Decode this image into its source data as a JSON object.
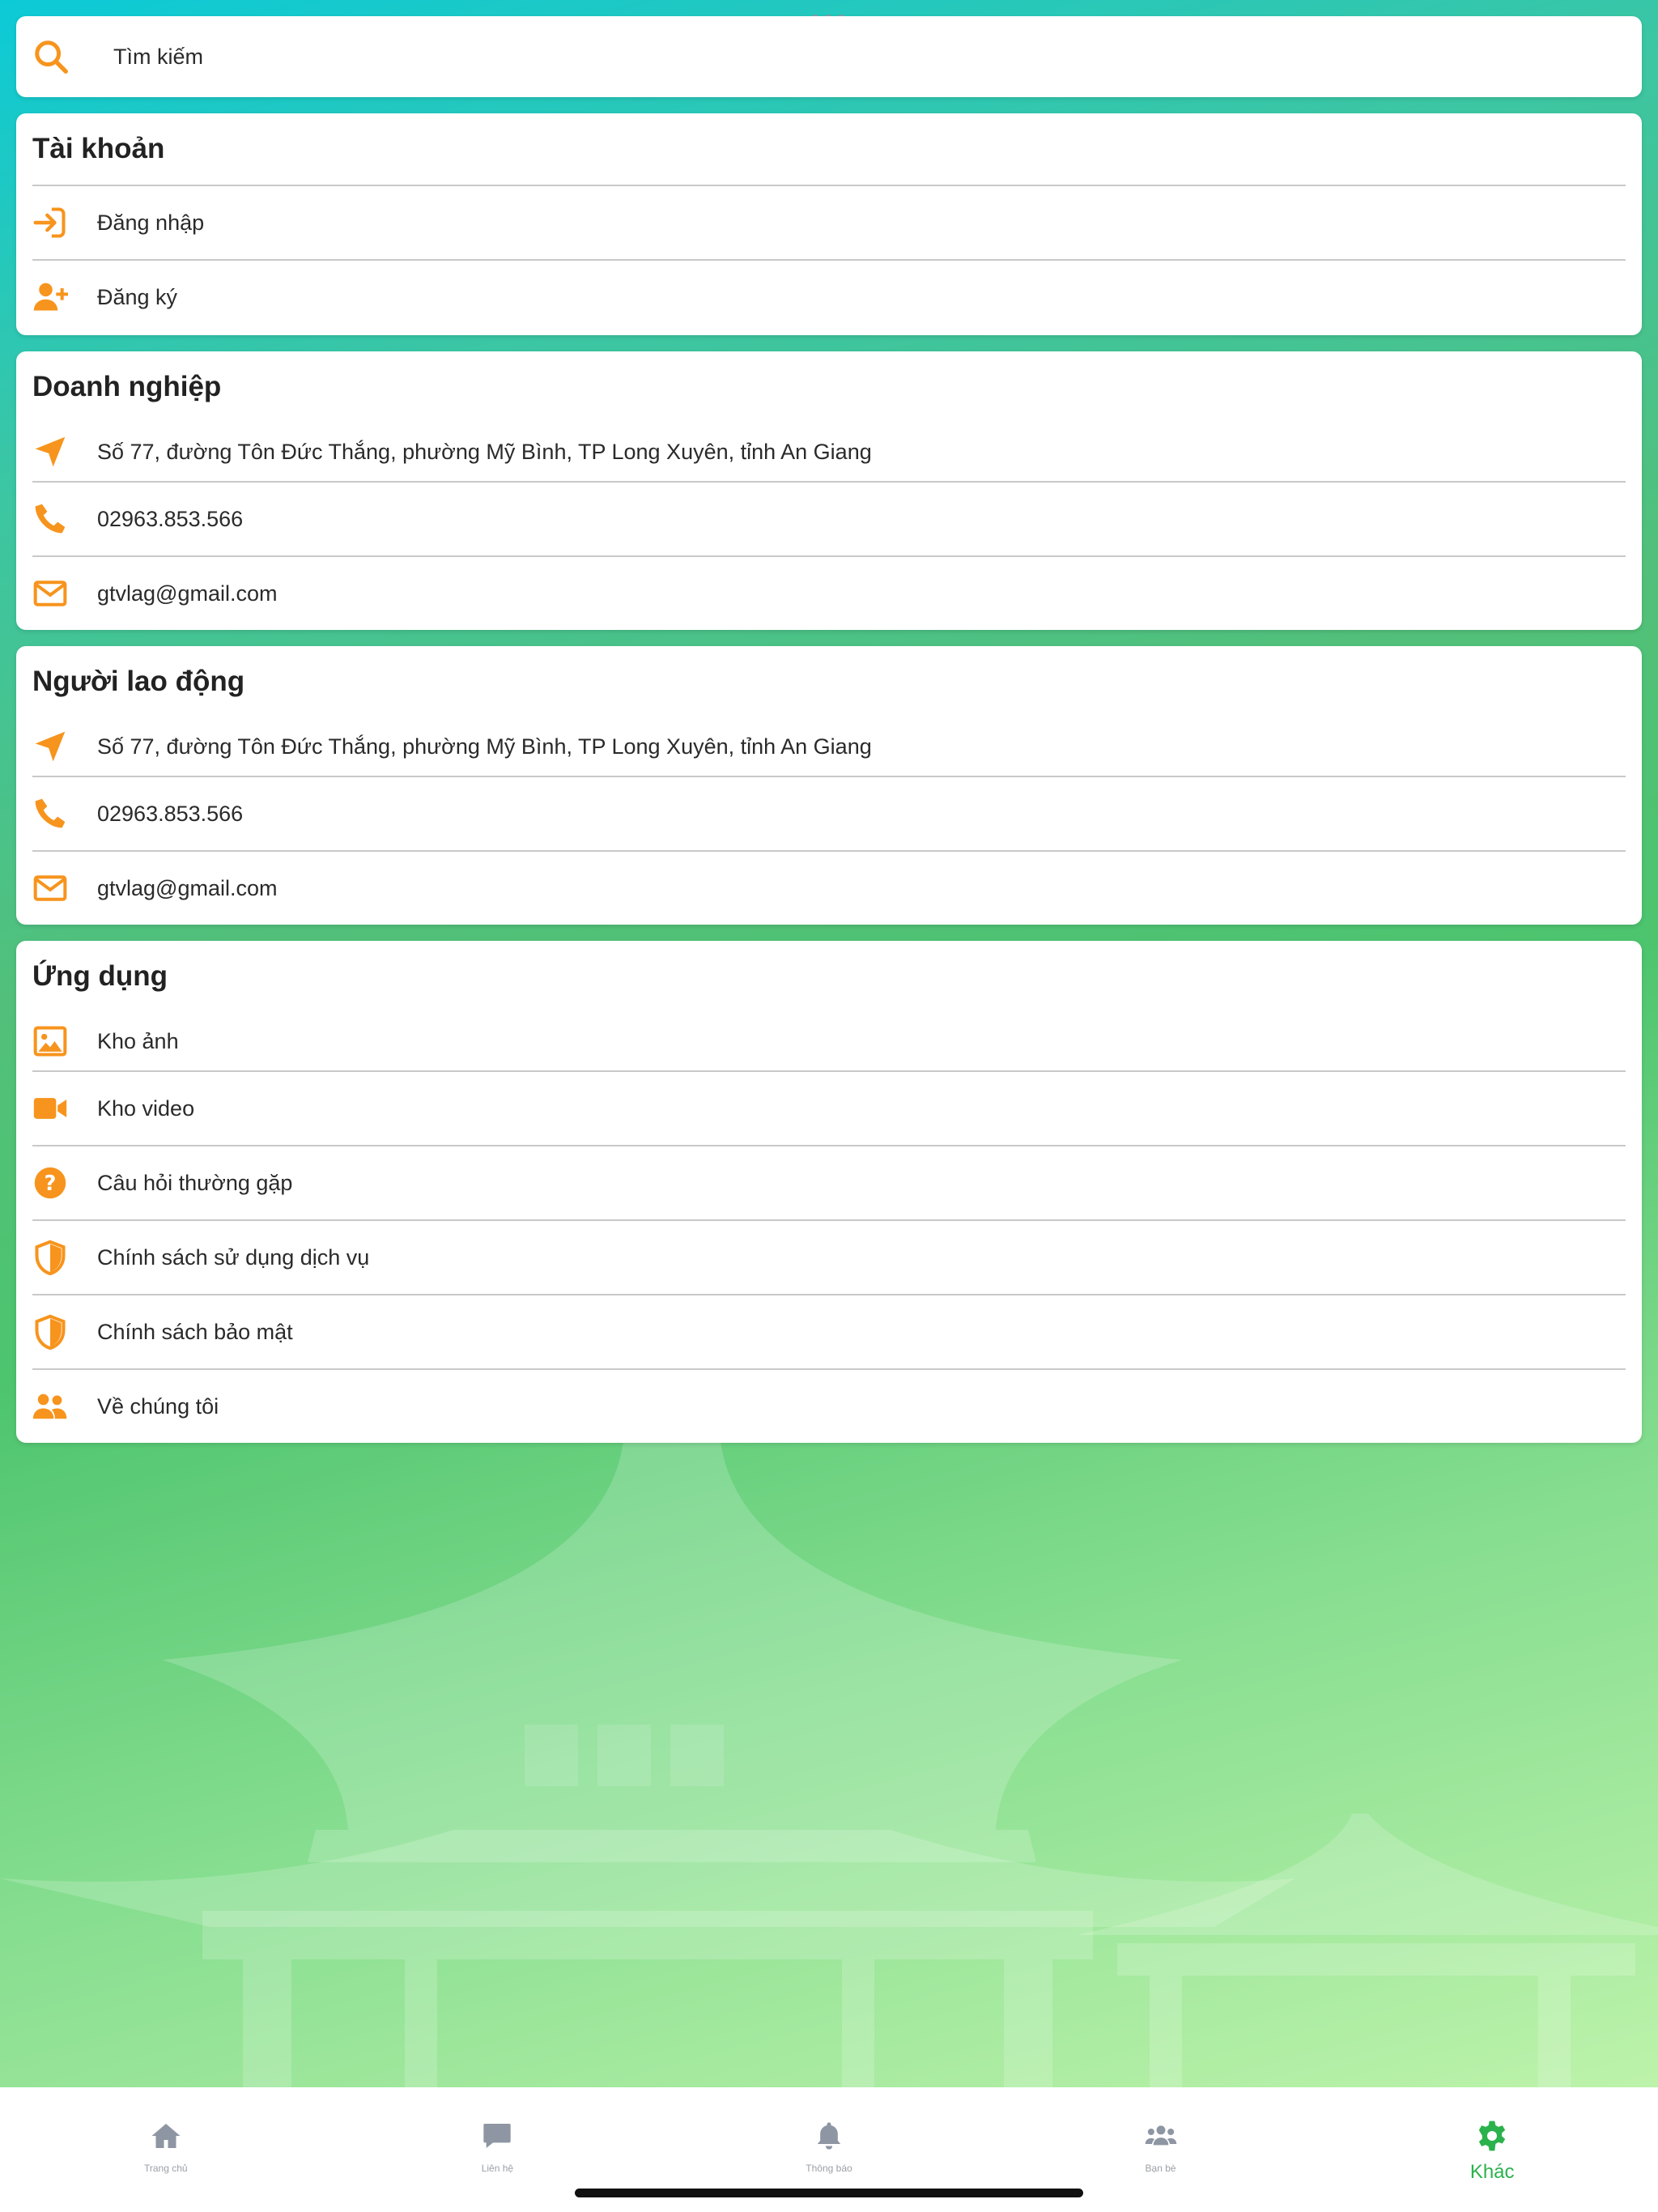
{
  "colors": {
    "accent": "#f7941d",
    "active_tab": "#2bb24c",
    "inactive_tab": "#8e96a3"
  },
  "search": {
    "label": "Tìm kiếm",
    "icon": "search-icon"
  },
  "account": {
    "title": "Tài khoản",
    "items": [
      {
        "label": "Đăng nhập",
        "icon": "login-icon"
      },
      {
        "label": "Đăng ký",
        "icon": "user-plus-icon"
      }
    ]
  },
  "business": {
    "title": "Doanh nghiệp",
    "address": "Số 77, đường Tôn Đức Thắng, phường Mỹ Bình, TP Long Xuyên, tỉnh An Giang",
    "phone": "02963.853.566",
    "email": "gtvlag@gmail.com"
  },
  "worker": {
    "title": "Người lao động",
    "address": "Số 77, đường Tôn Đức Thắng, phường Mỹ Bình, TP Long Xuyên, tỉnh An Giang",
    "phone": "02963.853.566",
    "email": "gtvlag@gmail.com"
  },
  "app": {
    "title": "Ứng dụng",
    "items": [
      {
        "label": "Kho ảnh",
        "icon": "image-icon"
      },
      {
        "label": "Kho video",
        "icon": "video-icon"
      },
      {
        "label": "Câu hỏi thường gặp",
        "icon": "question-icon"
      },
      {
        "label": "Chính sách sử dụng dịch vụ",
        "icon": "shield-icon"
      },
      {
        "label": "Chính sách bảo mật",
        "icon": "shield-icon"
      },
      {
        "label": "Về chúng tôi",
        "icon": "users-icon"
      }
    ]
  },
  "tabs": [
    {
      "label": "Trang chủ",
      "icon": "home-icon"
    },
    {
      "label": "Liên hệ",
      "icon": "chat-icon"
    },
    {
      "label": "Thông báo",
      "icon": "bell-icon"
    },
    {
      "label": "Bạn bè",
      "icon": "friends-icon"
    },
    {
      "label": "Khác",
      "icon": "gear-icon",
      "active": true
    }
  ]
}
